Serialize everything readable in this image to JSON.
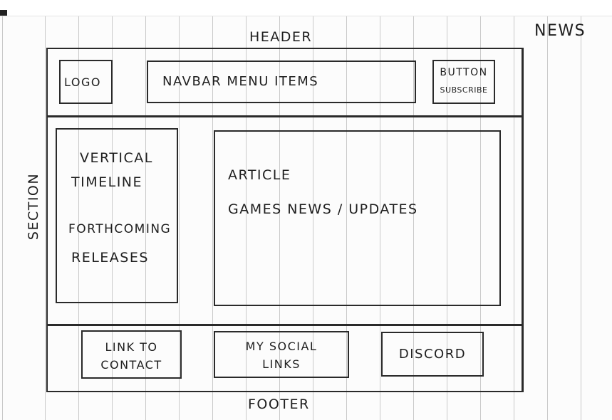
{
  "page_label": "NEWS",
  "header": {
    "label": "HEADER",
    "logo": "LOGO",
    "navbar": "NAVBAR MENU ITEMS",
    "button_line1": "BUTTON",
    "button_line2": "SUBSCRIBE"
  },
  "section": {
    "label": "SECTION",
    "sidebar": {
      "line1": "VERTICAL",
      "line2": "TIMELINE",
      "line3": "FORTHCOMING",
      "line4": "RELEASES"
    },
    "article": {
      "line1": "ARTICLE",
      "line2": "GAMES NEWS / UPDATES"
    }
  },
  "footer": {
    "label": "FOOTER",
    "contact_line1": "LINK TO",
    "contact_line2": "CONTACT",
    "social_line1": "MY SOCIAL",
    "social_line2": "LINKS",
    "discord": "DISCORD"
  }
}
